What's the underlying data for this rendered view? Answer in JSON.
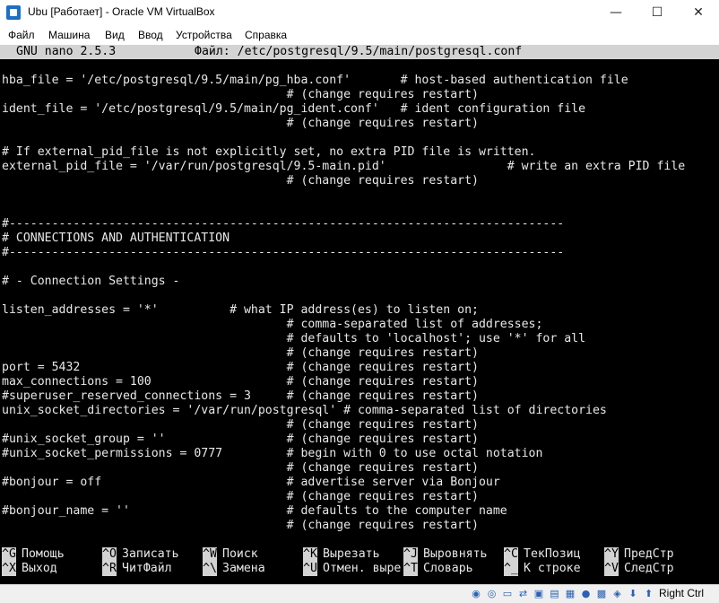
{
  "window": {
    "title": "Ubu [Работает] - Oracle VM VirtualBox",
    "minimize": "—",
    "maximize": "☐",
    "close": "✕"
  },
  "menu": [
    "Файл",
    "Машина",
    "Вид",
    "Ввод",
    "Устройства",
    "Справка"
  ],
  "nano": {
    "version": "GNU nano 2.5.3",
    "file": "Файл: /etc/postgresql/9.5/main/postgresql.conf"
  },
  "lines": [
    "hba_file = '/etc/postgresql/9.5/main/pg_hba.conf'       # host-based authentication file",
    "                                        # (change requires restart)",
    "ident_file = '/etc/postgresql/9.5/main/pg_ident.conf'   # ident configuration file",
    "                                        # (change requires restart)",
    "",
    "# If external_pid_file is not explicitly set, no extra PID file is written.",
    "external_pid_file = '/var/run/postgresql/9.5-main.pid'                 # write an extra PID file",
    "                                        # (change requires restart)",
    "",
    "",
    "#------------------------------------------------------------------------------",
    "# CONNECTIONS AND AUTHENTICATION",
    "#------------------------------------------------------------------------------",
    "",
    "# - Connection Settings -",
    "",
    "listen_addresses = '*'          # what IP address(es) to listen on;",
    "                                        # comma-separated list of addresses;",
    "                                        # defaults to 'localhost'; use '*' for all",
    "                                        # (change requires restart)",
    "port = 5432                             # (change requires restart)",
    "max_connections = 100                   # (change requires restart)",
    "#superuser_reserved_connections = 3     # (change requires restart)",
    "unix_socket_directories = '/var/run/postgresql' # comma-separated list of directories",
    "                                        # (change requires restart)",
    "#unix_socket_group = ''                 # (change requires restart)",
    "#unix_socket_permissions = 0777         # begin with 0 to use octal notation",
    "                                        # (change requires restart)",
    "#bonjour = off                          # advertise server via Bonjour",
    "                                        # (change requires restart)",
    "#bonjour_name = ''                      # defaults to the computer name",
    "                                        # (change requires restart)"
  ],
  "shortcuts_row1": [
    {
      "key": "^G",
      "label": "Помощь"
    },
    {
      "key": "^O",
      "label": "Записать"
    },
    {
      "key": "^W",
      "label": "Поиск"
    },
    {
      "key": "^K",
      "label": "Вырезать"
    },
    {
      "key": "^J",
      "label": "Выровнять"
    },
    {
      "key": "^C",
      "label": "ТекПозиц"
    },
    {
      "key": "^Y",
      "label": "ПредСтр"
    }
  ],
  "shortcuts_row2": [
    {
      "key": "^X",
      "label": "Выход"
    },
    {
      "key": "^R",
      "label": "ЧитФайл"
    },
    {
      "key": "^\\",
      "label": "Замена"
    },
    {
      "key": "^U",
      "label": "Отмен. выре"
    },
    {
      "key": "^T",
      "label": "Словарь"
    },
    {
      "key": "^_",
      "label": "К строке"
    },
    {
      "key": "^V",
      "label": "СледСтр"
    }
  ],
  "status": {
    "icons": [
      "disk-icon",
      "optical-icon",
      "network-icon",
      "usb-icon",
      "shared-folder-icon",
      "display-icon",
      "screen-icon",
      "recording-icon",
      "cpu-icon",
      "mouse-icon",
      "download-icon",
      "host-key-icon"
    ],
    "host_key": "Right Ctrl"
  }
}
